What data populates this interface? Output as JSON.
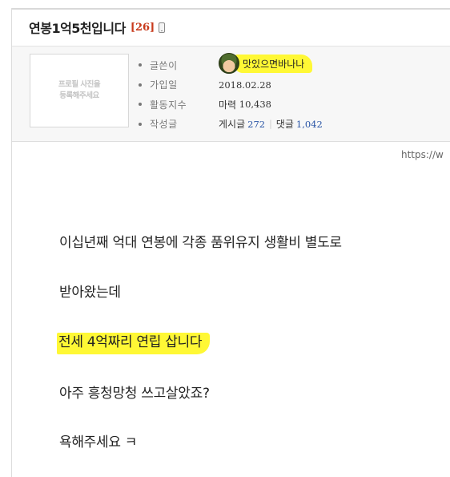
{
  "post": {
    "title": "연봉1억5천입니다",
    "comment_count": "[26]",
    "device_icon": "mobile-phone-icon",
    "url_fragment": "https://w"
  },
  "author_card": {
    "profile_placeholder": "프로필 사진을\n등록해주세요",
    "rows": {
      "writer": {
        "label": "글쓴이",
        "nickname": "맛있으면바나나"
      },
      "joined": {
        "label": "가입일",
        "value": "2018.02.28"
      },
      "activity": {
        "label": "활동지수",
        "prefix": "마력",
        "value": "10,438"
      },
      "posts": {
        "label": "작성글",
        "posts_label": "게시글",
        "posts_count": "272",
        "separator": "|",
        "comments_label": "댓글",
        "comments_count": "1,042"
      }
    }
  },
  "content": {
    "lines": [
      "이십년째 억대 연봉에 각종 품위유지 생활비 별도로",
      "받아왔는데",
      "전세 4억짜리 연립 삽니다",
      "아주 흥청망청 쓰고살았죠?",
      "욕해주세요 ㅋ"
    ]
  },
  "colors": {
    "highlight": "#fff835",
    "comment_count": "#c83a1c",
    "number_link": "#2a55a6"
  }
}
